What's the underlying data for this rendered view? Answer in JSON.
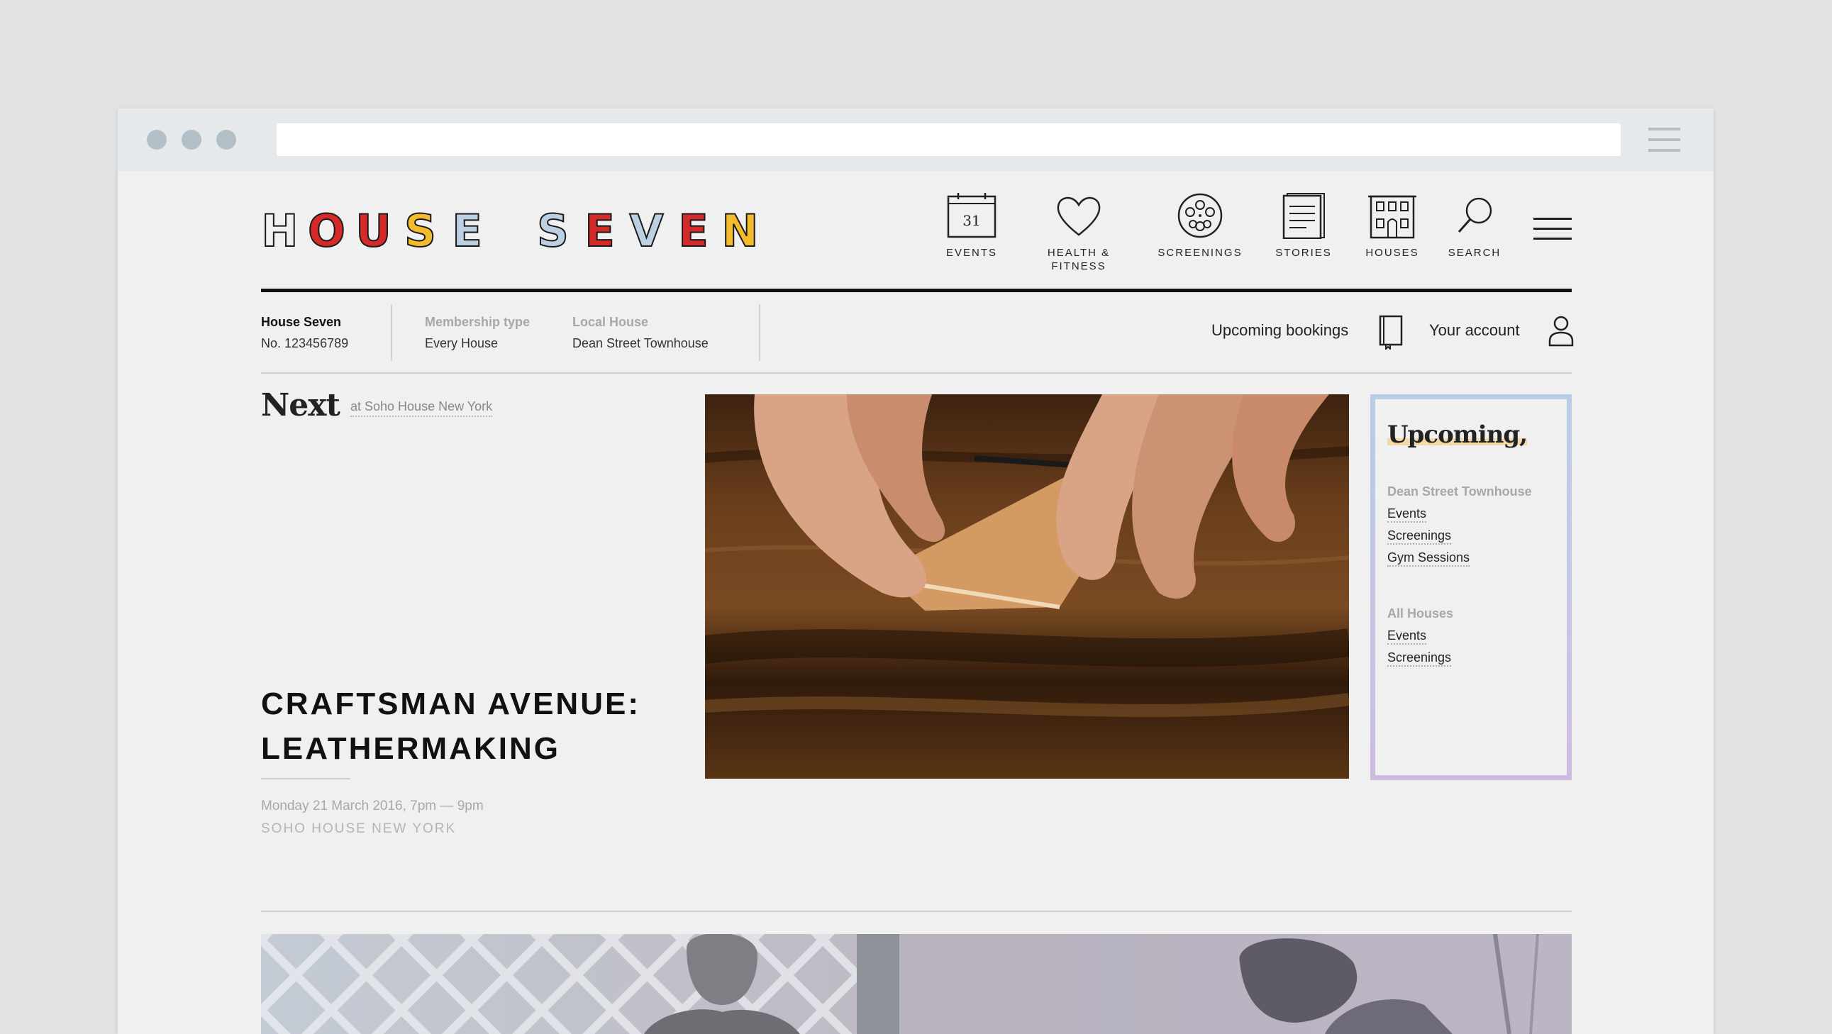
{
  "browser": {
    "url": ""
  },
  "header": {
    "logo_letters": [
      "H",
      "O",
      "U",
      "S",
      "E",
      "S",
      "E",
      "V",
      "E",
      "N"
    ],
    "logo_text": "HOUSE SEVEN",
    "nav": [
      {
        "label": "EVENTS",
        "icon": "calendar-icon",
        "badge": "31"
      },
      {
        "label": "HEALTH & FITNESS",
        "icon": "heart-icon"
      },
      {
        "label": "SCREENINGS",
        "icon": "film-reel-icon"
      },
      {
        "label": "STORIES",
        "icon": "document-icon"
      },
      {
        "label": "HOUSES",
        "icon": "building-icon"
      },
      {
        "label": "SEARCH",
        "icon": "search-icon"
      }
    ]
  },
  "account": {
    "member_name": "House Seven",
    "member_number": "No. 123456789",
    "membership_label": "Membership type",
    "membership_value": "Every House",
    "local_label": "Local House",
    "local_value": "Dean Street Townhouse",
    "bookings_label": "Upcoming bookings",
    "account_label": "Your account"
  },
  "next": {
    "heading": "Next",
    "location": "at Soho House New York",
    "title": "CRAFTSMAN AVENUE: LEATHERMAKING",
    "date": "Monday 21 March 2016, 7pm — 9pm",
    "place": "SOHO HOUSE NEW YORK"
  },
  "upcoming": {
    "title": "Upcoming,",
    "groups": [
      {
        "heading": "Dean Street Townhouse",
        "links": [
          "Events",
          "Screenings",
          "Gym Sessions"
        ]
      },
      {
        "heading": "All Houses",
        "links": [
          "Events",
          "Screenings"
        ]
      }
    ]
  },
  "colors": {
    "logo_red": "#d42a2a",
    "logo_yellow": "#f2bb2c",
    "logo_blue": "#bcd0e4",
    "logo_lilac": "#c9b8dc",
    "upcoming_border_top": "#b9cde6",
    "upcoming_border_bottom": "#cdbbe0",
    "highlight": "#f4d9a6"
  }
}
